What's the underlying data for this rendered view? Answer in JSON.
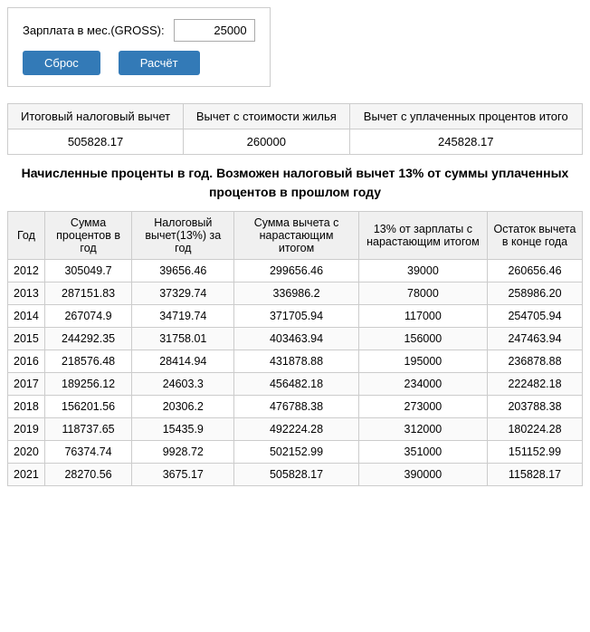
{
  "salary": {
    "label": "Зарплата в мес.(GROSS):",
    "value": "25000",
    "reset_label": "Сброс",
    "calc_label": "Расчёт"
  },
  "summary": {
    "headers": [
      "Итоговый налоговый вычет",
      "Вычет с стоимости жилья",
      "Вычет с уплаченных процентов итого"
    ],
    "values": [
      "505828.17",
      "260000",
      "245828.17"
    ]
  },
  "info_text": "Начисленные проценты в год. Возможен налоговый вычет 13% от суммы уплаченных процентов в прошлом году",
  "table": {
    "headers": [
      "Год",
      "Сумма процентов в год",
      "Налоговый вычет(13%) за год",
      "Сумма вычета с нарастающим итогом",
      "13% от зарплаты с нарастающим итогом",
      "Остаток вычета в конце года"
    ],
    "rows": [
      [
        "2012",
        "305049.7",
        "39656.46",
        "299656.46",
        "39000",
        "260656.46"
      ],
      [
        "2013",
        "287151.83",
        "37329.74",
        "336986.2",
        "78000",
        "258986.20"
      ],
      [
        "2014",
        "267074.9",
        "34719.74",
        "371705.94",
        "117000",
        "254705.94"
      ],
      [
        "2015",
        "244292.35",
        "31758.01",
        "403463.94",
        "156000",
        "247463.94"
      ],
      [
        "2016",
        "218576.48",
        "28414.94",
        "431878.88",
        "195000",
        "236878.88"
      ],
      [
        "2017",
        "189256.12",
        "24603.3",
        "456482.18",
        "234000",
        "222482.18"
      ],
      [
        "2018",
        "156201.56",
        "20306.2",
        "476788.38",
        "273000",
        "203788.38"
      ],
      [
        "2019",
        "118737.65",
        "15435.9",
        "492224.28",
        "312000",
        "180224.28"
      ],
      [
        "2020",
        "76374.74",
        "9928.72",
        "502152.99",
        "351000",
        "151152.99"
      ],
      [
        "2021",
        "28270.56",
        "3675.17",
        "505828.17",
        "390000",
        "115828.17"
      ]
    ]
  }
}
